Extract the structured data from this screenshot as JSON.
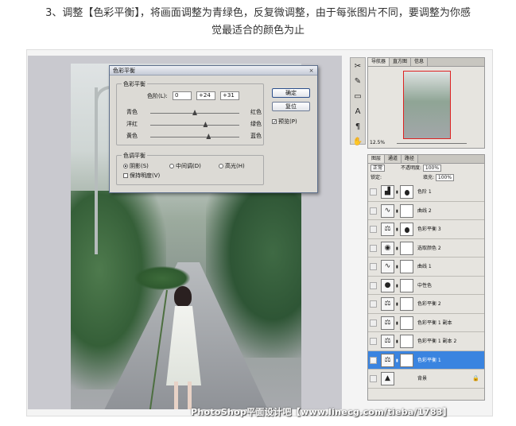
{
  "caption": {
    "line1": "3、调整【色彩平衡】，将画面调整为青绿色，反复微调整，由于每张图片不同，要调整为你感",
    "line2": "觉最适合的颜色为止"
  },
  "dialog": {
    "title": "色彩平衡",
    "close_glyph": "×",
    "balance_group": "色彩平衡",
    "levels_label": "色阶(L):",
    "levels": [
      "0",
      "+24",
      "+31"
    ],
    "sliders": [
      {
        "left": "青色",
        "right": "红色",
        "value": 0
      },
      {
        "left": "洋红",
        "right": "绿色",
        "value": 24
      },
      {
        "left": "黄色",
        "right": "蓝色",
        "value": 31
      }
    ],
    "tone_group": "色调平衡",
    "tones": [
      {
        "label": "阴影(S)",
        "checked": true
      },
      {
        "label": "中间调(D)",
        "checked": false
      },
      {
        "label": "高光(H)",
        "checked": false
      }
    ],
    "preserve_label": "保持明度(V)",
    "preserve_checked": false,
    "ok_label": "确定",
    "reset_label": "复位",
    "preview_label": "预览(P)",
    "preview_checked": true
  },
  "navigator": {
    "tabs": [
      "导航器",
      "直方图",
      "信息"
    ],
    "zoom": "12.5%"
  },
  "layers": {
    "tabs": [
      "图层",
      "通道",
      "路径"
    ],
    "blend_mode": "正常",
    "opacity_label": "不透明度:",
    "opacity": "100%",
    "lock_label": "锁定:",
    "fill_label": "填充:",
    "fill": "100%",
    "items": [
      {
        "name": "色阶 1",
        "icon": "levels-icon",
        "glyph": "▟",
        "has_mask": true,
        "mask_dot": true,
        "selected": false
      },
      {
        "name": "曲线 2",
        "icon": "curves-icon",
        "glyph": "∿",
        "has_mask": true,
        "mask_dot": false,
        "selected": false
      },
      {
        "name": "色彩平衡 3",
        "icon": "balance-icon",
        "glyph": "⚖",
        "has_mask": true,
        "mask_dot": true,
        "selected": false
      },
      {
        "name": "选取颜色 2",
        "icon": "selective-color-icon",
        "glyph": "◉",
        "has_mask": true,
        "mask_dot": false,
        "selected": false
      },
      {
        "name": "曲线 1",
        "icon": "curves-icon",
        "glyph": "∿",
        "has_mask": true,
        "mask_dot": false,
        "selected": false
      },
      {
        "name": "中性色",
        "icon": "solid-color-icon",
        "glyph": "●",
        "has_mask": true,
        "mask_dot": false,
        "selected": false
      },
      {
        "name": "色彩平衡 2",
        "icon": "balance-icon",
        "glyph": "⚖",
        "has_mask": true,
        "mask_dot": false,
        "selected": false
      },
      {
        "name": "色彩平衡 1 副本",
        "icon": "balance-icon",
        "glyph": "⚖",
        "has_mask": true,
        "mask_dot": false,
        "selected": false
      },
      {
        "name": "色彩平衡 1 副本 2",
        "icon": "balance-icon",
        "glyph": "⚖",
        "has_mask": true,
        "mask_dot": false,
        "selected": false
      },
      {
        "name": "色彩平衡 1",
        "icon": "balance-icon",
        "glyph": "⚖",
        "has_mask": true,
        "mask_dot": false,
        "selected": true
      },
      {
        "name": "背景",
        "icon": "image-icon",
        "glyph": "▲",
        "has_mask": false,
        "mask_dot": false,
        "selected": false,
        "locked": true
      }
    ]
  },
  "tools": [
    "✂",
    "✎",
    "▭",
    "A",
    "¶",
    "✋"
  ],
  "watermark": "PhotoShop平面设计吧【www.linecg.com/tieba/1783】"
}
